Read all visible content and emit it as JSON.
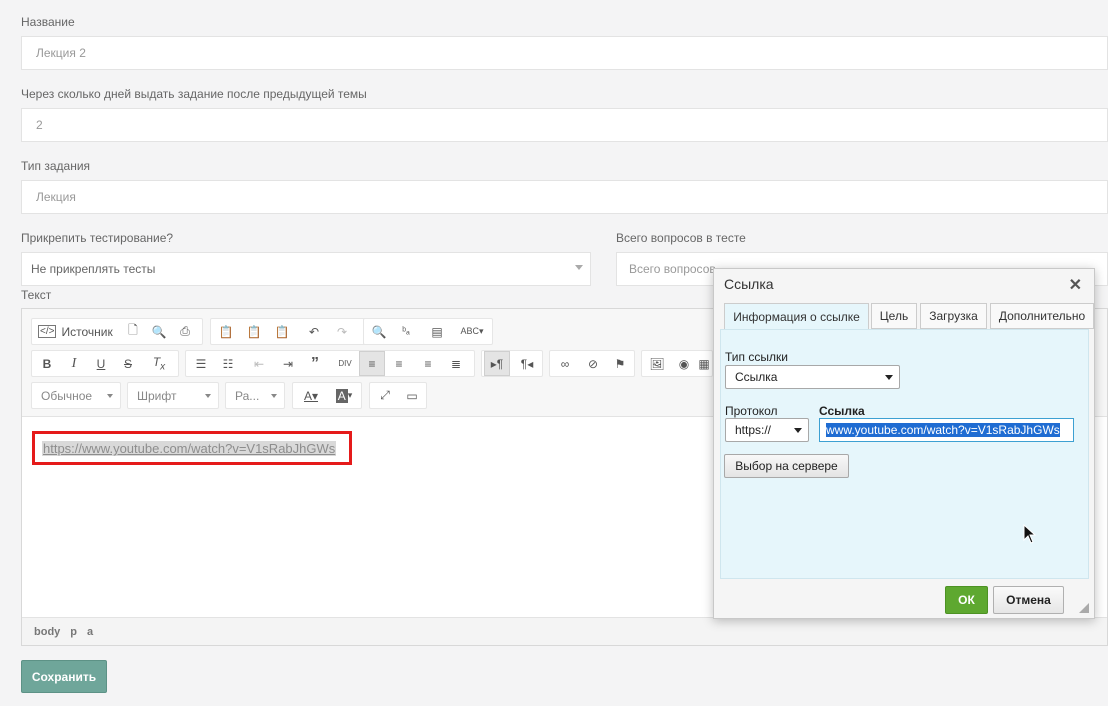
{
  "form": {
    "name_label": "Название",
    "name_value": "Лекция 2",
    "days_label": "Через сколько дней выдать задание после предыдущей темы",
    "days_value": "2",
    "type_label": "Тип задания",
    "type_value": "Лекция",
    "attach_label": "Прикрепить тестирование?",
    "attach_value": "Не прикреплять тесты",
    "total_label": "Всего вопросов в тесте",
    "total_placeholder": "Всего вопросов",
    "text_label": "Текст",
    "save_label": "Сохранить"
  },
  "editor": {
    "source_label": "Источник",
    "format_label": "Обычное",
    "font_label": "Шрифт",
    "size_label": "Ра...",
    "link_text": "https://www.youtube.com/watch?v=V1sRabJhGWs",
    "path": [
      "body",
      "p",
      "a"
    ]
  },
  "dialog": {
    "title": "Ссылка",
    "tabs": [
      "Информация о ссылке",
      "Цель",
      "Загрузка",
      "Дополнительно"
    ],
    "link_type_label": "Тип ссылки",
    "link_type_value": "Ссылка",
    "protocol_label": "Протокол",
    "protocol_value": "https://",
    "url_label": "Ссылка",
    "url_value": "www.youtube.com/watch?v=V1sRabJhGWs",
    "browse_label": "Выбор на сервере",
    "ok_label": "ОК",
    "cancel_label": "Отмена"
  },
  "colors": {
    "highlight": "#e51a1a",
    "save": "#6fa69a",
    "ok": "#5ea830",
    "dialog_body": "#e6f6fb"
  }
}
